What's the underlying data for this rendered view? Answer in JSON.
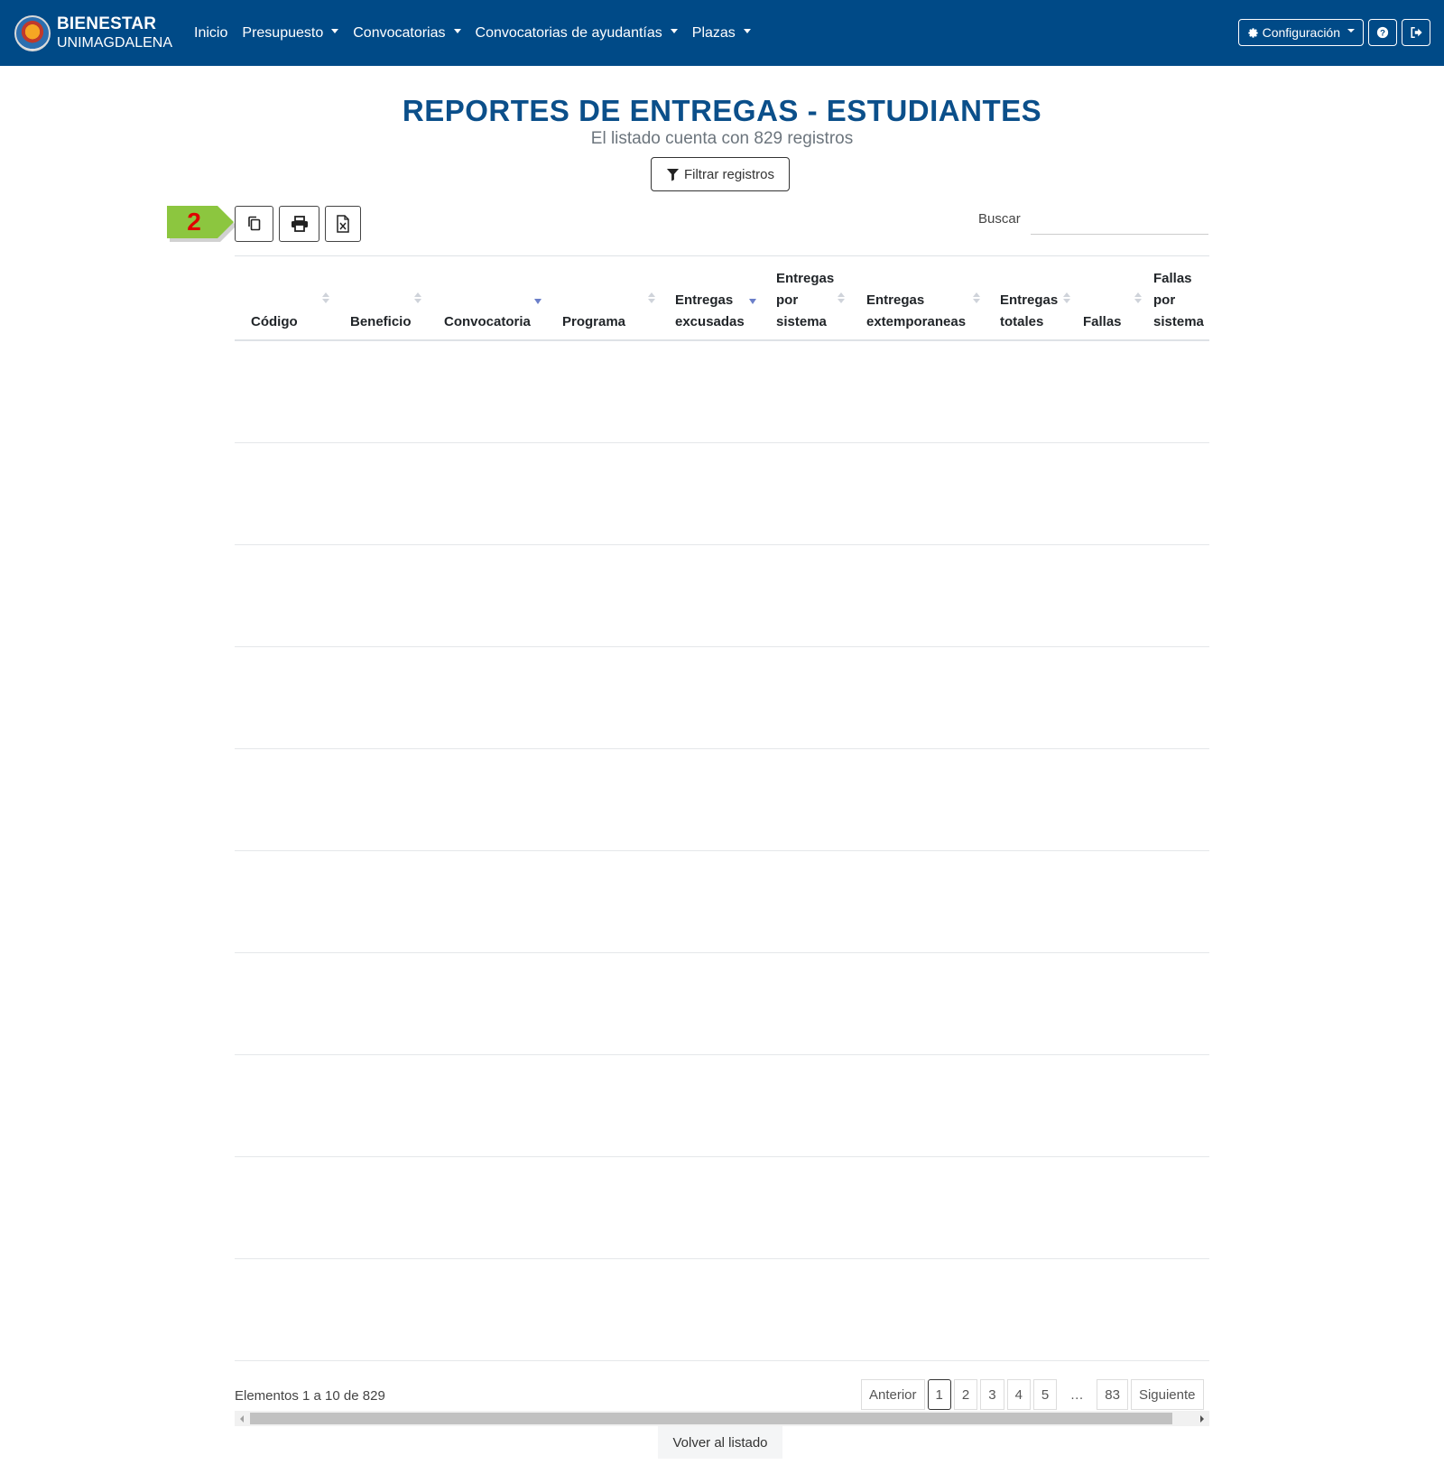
{
  "navbar": {
    "brand_title": "BIENESTAR",
    "brand_sub": "UNIMAGDALENA",
    "items": [
      {
        "label": "Inicio",
        "dropdown": false
      },
      {
        "label": "Presupuesto",
        "dropdown": true
      },
      {
        "label": "Convocatorias",
        "dropdown": true
      },
      {
        "label": "Convocatorias de ayudantías",
        "dropdown": true
      },
      {
        "label": "Plazas",
        "dropdown": true
      }
    ],
    "config_label": "Configuración",
    "color": "#004a87"
  },
  "page": {
    "title": "REPORTES DE ENTREGAS - ESTUDIANTES",
    "subtitle": "El listado cuenta con 829 registros",
    "filter_label": "Filtrar registros"
  },
  "step_marker": {
    "number": "2",
    "color": "#8cc63f"
  },
  "toolbar": {
    "buttons": [
      "copy-icon",
      "print-icon",
      "excel-icon"
    ],
    "search_label": "Buscar",
    "search_value": ""
  },
  "table": {
    "columns": [
      {
        "lines": [
          "Código"
        ],
        "sort": "none"
      },
      {
        "lines": [
          "Beneficio"
        ],
        "sort": "none"
      },
      {
        "lines": [
          "Convocatoria"
        ],
        "sort": "desc"
      },
      {
        "lines": [
          "Programa"
        ],
        "sort": "none"
      },
      {
        "lines": [
          "Entregas",
          "excusadas"
        ],
        "sort": "desc"
      },
      {
        "lines": [
          "Entregas",
          "por",
          "sistema"
        ],
        "sort": "none"
      },
      {
        "lines": [
          "Entregas",
          "extemporaneas"
        ],
        "sort": "none"
      },
      {
        "lines": [
          "Entregas",
          "totales"
        ],
        "sort": "none"
      },
      {
        "lines": [
          "Fallas"
        ],
        "sort": "none"
      },
      {
        "lines": [
          "Fallas",
          "por",
          "sistema"
        ],
        "sort": "none"
      }
    ],
    "row_count": 10
  },
  "footer": {
    "info": "Elementos 1 a 10 de 829",
    "pagination": [
      "Anterior",
      "1",
      "2",
      "3",
      "4",
      "5",
      "…",
      "83",
      "Siguiente"
    ],
    "active_page": "1",
    "back_label": "Volver al listado"
  }
}
